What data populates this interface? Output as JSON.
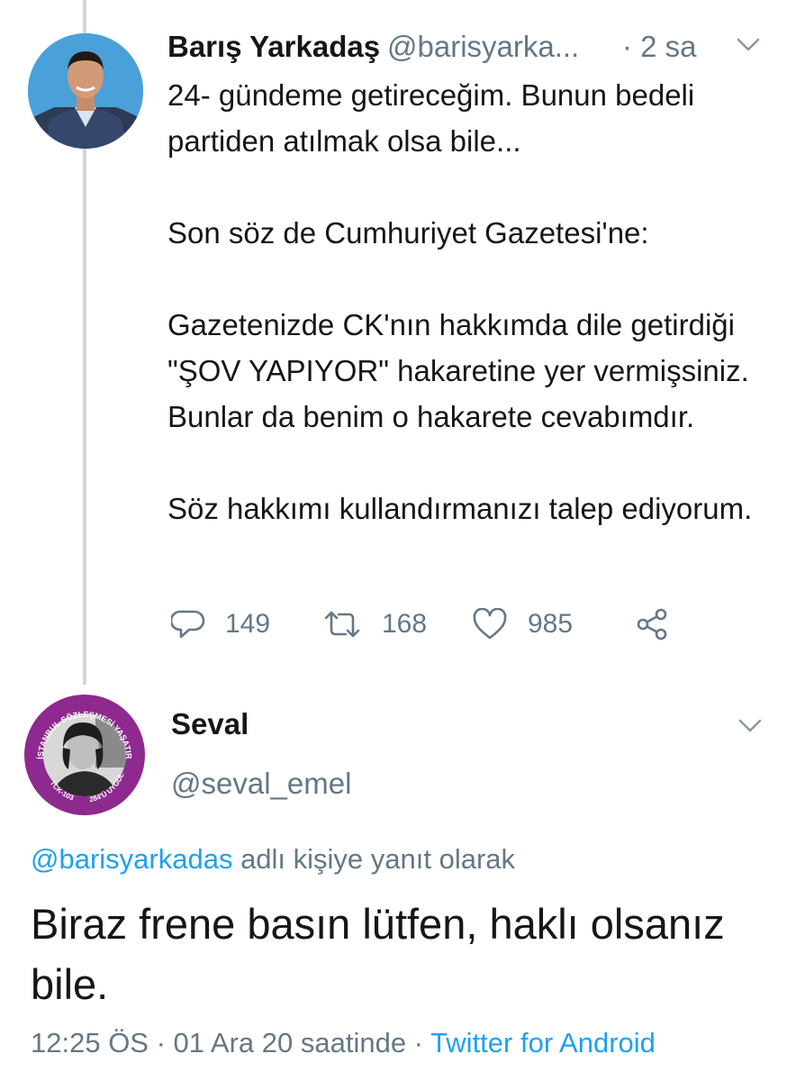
{
  "tweet": {
    "author_name": "Barış Yarkadaş",
    "author_handle": "@barisyarka...",
    "time": "· 2 sa",
    "paragraphs": [
      "24- gündeme getireceğim. Bunun bedeli partiden atılmak olsa bile...",
      "Son söz de Cumhuriyet Gazetesi'ne:",
      "Gazetenizde CK'nın hakkımda dile getirdiği \"ŞOV YAPIYOR\" hakaretine yer vermişsiniz. Bunlar da benim o hakarete cevabımdır.",
      "Söz hakkımı kullandırmanızı talep ediyorum."
    ],
    "reply_count": "149",
    "retweet_count": "168",
    "like_count": "985"
  },
  "reply": {
    "author_name": "Seval",
    "author_handle": "@seval_emel",
    "reply_to_handle": "@barisyarkadas",
    "reply_to_suffix": " adlı kişiye yanıt olarak",
    "text": "Biraz frene basın lütfen, haklı olsanız bile.",
    "timestamp": "12:25 ÖS · 01 Ara 20 saatinde · ",
    "client": "Twitter for Android",
    "avatar_badge_top": "İSTANBUL SÖZLEŞMESİ YAŞATIR",
    "avatar_badge_left": "TCK-103",
    "avatar_badge_right": "6284'Ü UYGULA"
  },
  "colors": {
    "link": "#1da1f2",
    "secondary_text": "#657786",
    "primary_text": "#14171a",
    "thread_line": "#ccd6dd",
    "badge_purple": "#8e2a8f"
  },
  "icons": {
    "reply": "speech-bubble-icon",
    "retweet": "retweet-arrows-icon",
    "like": "heart-outline-icon",
    "share": "share-nodes-icon",
    "menu": "chevron-down-icon"
  }
}
